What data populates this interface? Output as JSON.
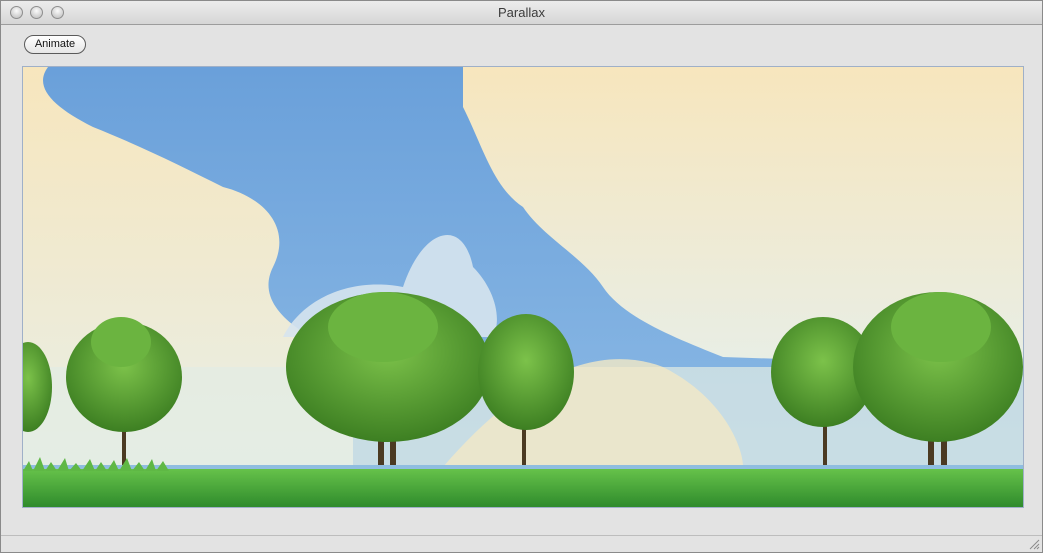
{
  "window": {
    "title": "Parallax"
  },
  "toolbar": {
    "animate_label": "Animate"
  },
  "colors": {
    "sky": "#6fa3db",
    "cloud_warm": "#f5e8c0",
    "cloud_light": "#e6efe9",
    "grass": "#4aa83a",
    "tree_leaf": "#4f9a2d",
    "trunk": "#4b3a22"
  },
  "icons": {
    "close": "traffic-close",
    "minimize": "traffic-minimize",
    "zoom": "traffic-zoom",
    "resize": "resize-grip"
  }
}
